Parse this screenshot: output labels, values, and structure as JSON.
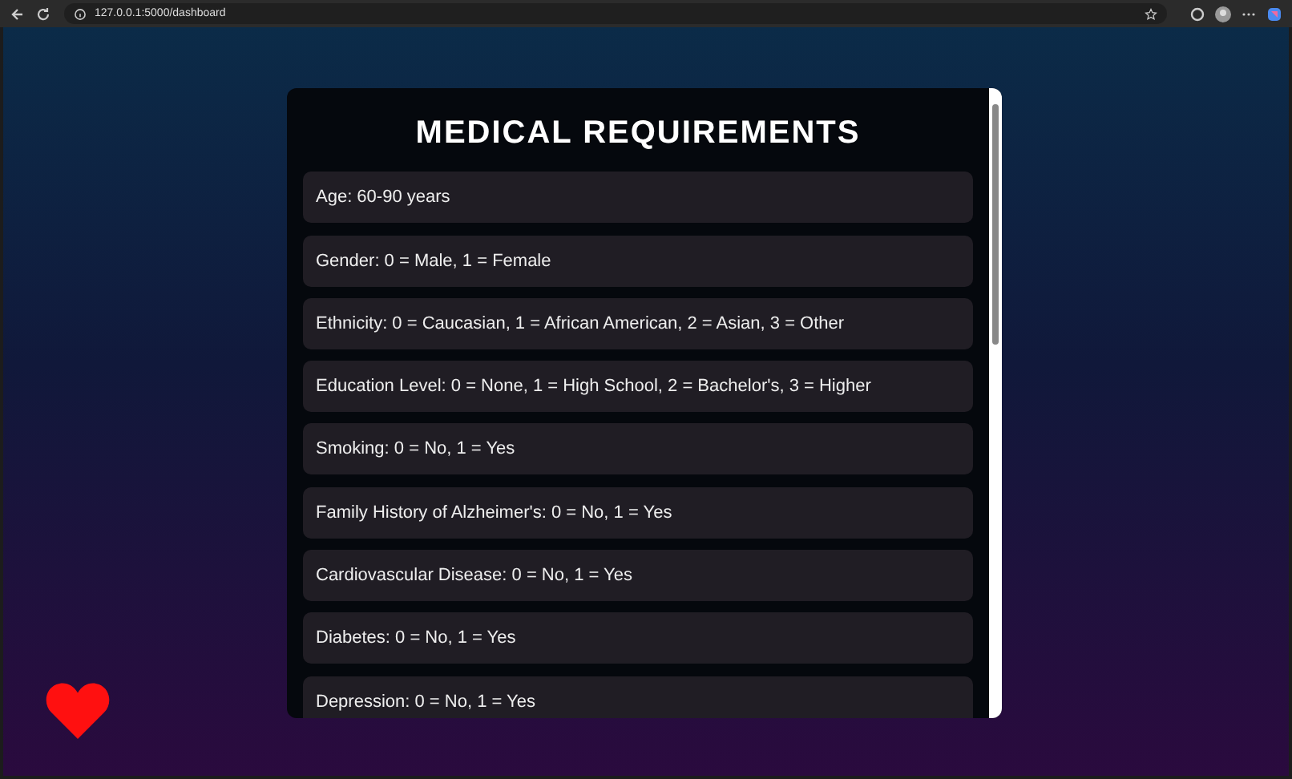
{
  "browser": {
    "url": "127.0.0.1:5000/dashboard"
  },
  "card": {
    "title": "MEDICAL REQUIREMENTS",
    "items": [
      "Age: 60-90 years",
      "Gender: 0 = Male, 1 = Female",
      "Ethnicity: 0 = Caucasian, 1 = African American, 2 = Asian, 3 = Other",
      "Education Level: 0 = None, 1 = High School, 2 = Bachelor's, 3 = Higher",
      "Smoking: 0 = No, 1 = Yes",
      "Family History of Alzheimer's: 0 = No, 1 = Yes",
      "Cardiovascular Disease: 0 = No, 1 = Yes",
      "Diabetes: 0 = No, 1 = Yes",
      "Depression: 0 = No, 1 = Yes"
    ]
  }
}
